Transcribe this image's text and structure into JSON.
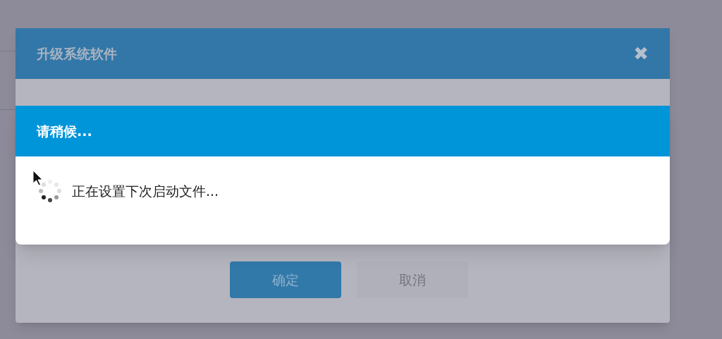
{
  "dialog": {
    "title": "升级系统软件",
    "close": "✖",
    "buttons": [
      {
        "label": "确定",
        "kind": "primary"
      },
      {
        "label": "取消",
        "kind": "secondary"
      }
    ]
  },
  "progress": {
    "title": "请稍候...",
    "message": "正在设置下次启动文件..."
  }
}
